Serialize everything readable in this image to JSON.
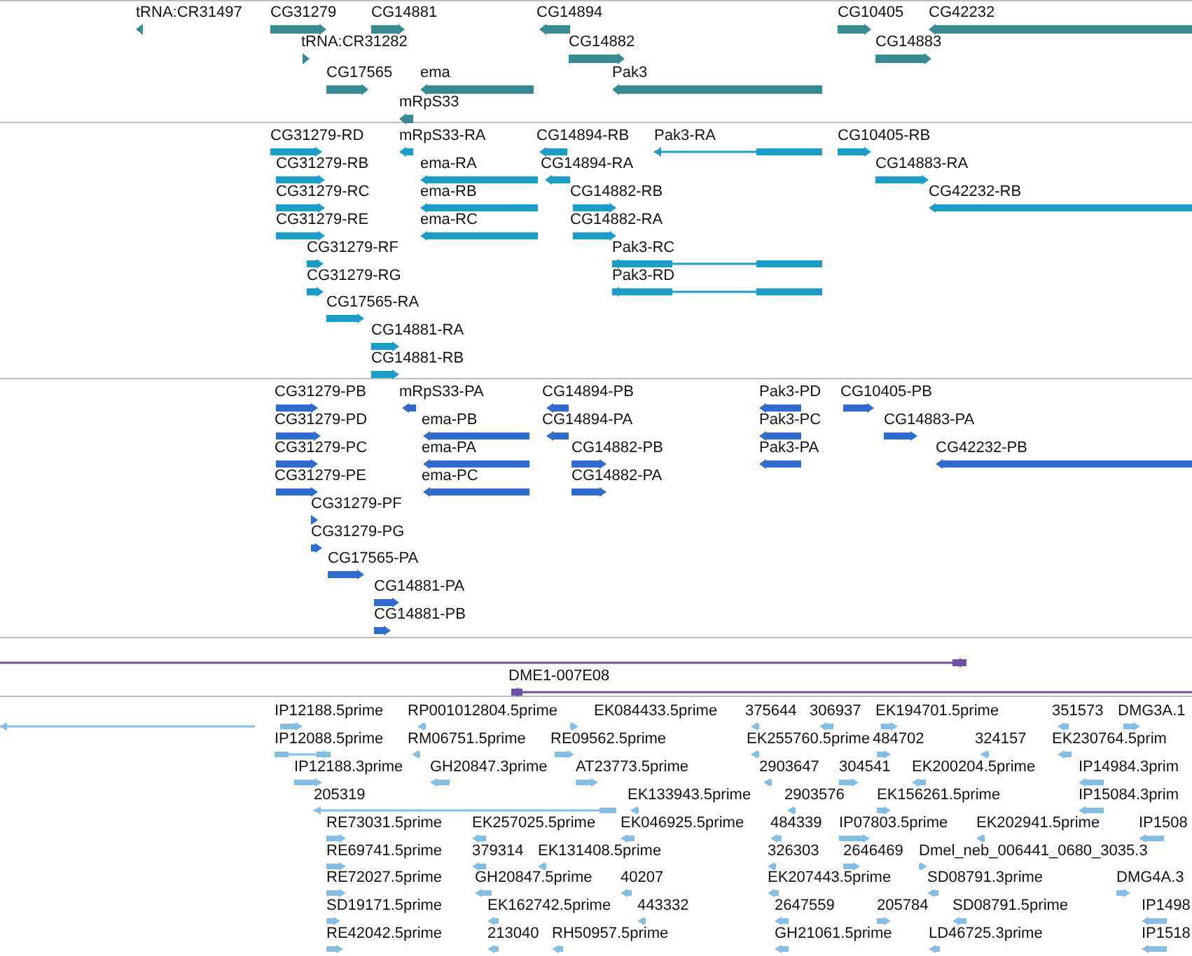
{
  "tracks": [
    {
      "color": "#368c92",
      "features": [
        {
          "label": "tRNA:CR31497",
          "reverse_strand": true
        },
        {
          "label": "CG31279",
          "reverse_strand": false
        },
        {
          "label": "CG14881",
          "reverse_strand": false
        },
        {
          "label": "CG14894",
          "reverse_strand": true
        },
        {
          "label": "CG10405",
          "reverse_strand": false
        },
        {
          "label": "CG42232",
          "reverse_strand": true
        },
        {
          "label": "tRNA:CR31282",
          "reverse_strand": false
        },
        {
          "label": "CG14882",
          "reverse_strand": false
        },
        {
          "label": "CG14883",
          "reverse_strand": false
        },
        {
          "label": "CG17565",
          "reverse_strand": false
        },
        {
          "label": "ema",
          "reverse_strand": true
        },
        {
          "label": "Pak3",
          "reverse_strand": true
        },
        {
          "label": "mRpS33",
          "reverse_strand": true
        }
      ]
    },
    {
      "color": "#1a9dc9",
      "features": [
        {
          "label": "CG31279-RD",
          "reverse_strand": false
        },
        {
          "label": "mRpS33-RA",
          "reverse_strand": true
        },
        {
          "label": "CG14894-RB",
          "reverse_strand": true
        },
        {
          "label": "Pak3-RA",
          "reverse_strand": true
        },
        {
          "label": "CG10405-RB",
          "reverse_strand": false
        },
        {
          "label": "CG31279-RB",
          "reverse_strand": false
        },
        {
          "label": "ema-RA",
          "reverse_strand": true
        },
        {
          "label": "CG14894-RA",
          "reverse_strand": true
        },
        {
          "label": "CG14883-RA",
          "reverse_strand": false
        },
        {
          "label": "CG31279-RC",
          "reverse_strand": false
        },
        {
          "label": "ema-RB",
          "reverse_strand": true
        },
        {
          "label": "CG14882-RB",
          "reverse_strand": false
        },
        {
          "label": "CG42232-RB",
          "reverse_strand": true
        },
        {
          "label": "CG31279-RE",
          "reverse_strand": false
        },
        {
          "label": "ema-RC",
          "reverse_strand": true
        },
        {
          "label": "CG14882-RA",
          "reverse_strand": false
        },
        {
          "label": "CG31279-RF",
          "reverse_strand": false
        },
        {
          "label": "Pak3-RC",
          "reverse_strand": true
        },
        {
          "label": "CG31279-RG",
          "reverse_strand": false
        },
        {
          "label": "Pak3-RD",
          "reverse_strand": true
        },
        {
          "label": "CG17565-RA",
          "reverse_strand": false
        },
        {
          "label": "CG14881-RA",
          "reverse_strand": false
        },
        {
          "label": "CG14881-RB",
          "reverse_strand": false
        }
      ]
    },
    {
      "color": "#2f6bd0",
      "features": [
        {
          "label": "CG31279-PB",
          "reverse_strand": false
        },
        {
          "label": "mRpS33-PA",
          "reverse_strand": true
        },
        {
          "label": "CG14894-PB",
          "reverse_strand": true
        },
        {
          "label": "Pak3-PD",
          "reverse_strand": true
        },
        {
          "label": "CG10405-PB",
          "reverse_strand": false
        },
        {
          "label": "CG31279-PD",
          "reverse_strand": false
        },
        {
          "label": "ema-PB",
          "reverse_strand": true
        },
        {
          "label": "CG14894-PA",
          "reverse_strand": true
        },
        {
          "label": "Pak3-PC",
          "reverse_strand": true
        },
        {
          "label": "CG14883-PA",
          "reverse_strand": false
        },
        {
          "label": "CG31279-PC",
          "reverse_strand": false
        },
        {
          "label": "ema-PA",
          "reverse_strand": true
        },
        {
          "label": "CG14882-PB",
          "reverse_strand": false
        },
        {
          "label": "Pak3-PA",
          "reverse_strand": true
        },
        {
          "label": "CG42232-PB",
          "reverse_strand": true
        },
        {
          "label": "CG31279-PE",
          "reverse_strand": false
        },
        {
          "label": "ema-PC",
          "reverse_strand": true
        },
        {
          "label": "CG14882-PA",
          "reverse_strand": false
        },
        {
          "label": "CG31279-PF",
          "reverse_strand": false
        },
        {
          "label": "CG31279-PG",
          "reverse_strand": false
        },
        {
          "label": "CG17565-PA",
          "reverse_strand": false
        },
        {
          "label": "CG14881-PA",
          "reverse_strand": false
        },
        {
          "label": "CG14881-PB",
          "reverse_strand": false
        }
      ]
    },
    {
      "color": "#6e4fae",
      "features": [
        {
          "reverse_strand": false
        },
        {
          "label": "DME1-007E08",
          "reverse_strand": true
        }
      ]
    },
    {
      "color": "#86bde2",
      "features": [
        {
          "reverse_strand": true
        },
        {
          "label": "IP12188.5prime",
          "reverse_strand": false
        },
        {
          "label": "RP001012804.5prime",
          "reverse_strand": true
        },
        {
          "label": "EK084433.5prime",
          "reverse_strand": false
        },
        {
          "label": "375644",
          "reverse_strand": true
        },
        {
          "label": "306937",
          "reverse_strand": true
        },
        {
          "label": "EK194701.5prime",
          "reverse_strand": false
        },
        {
          "label": "351573",
          "reverse_strand": true
        },
        {
          "label": "DMG3A.1",
          "reverse_strand": false
        },
        {
          "label": "IP12088.5prime",
          "reverse_strand": false
        },
        {
          "label": "RM06751.5prime",
          "reverse_strand": true
        },
        {
          "label": "RE09562.5prime",
          "reverse_strand": false
        },
        {
          "label": "EK255760.5prime",
          "reverse_strand": true
        },
        {
          "label": "484702",
          "reverse_strand": false
        },
        {
          "label": "324157",
          "reverse_strand": true
        },
        {
          "label": "EK230764.5prim",
          "reverse_strand": true
        },
        {
          "label": "IP12188.3prime",
          "reverse_strand": false
        },
        {
          "label": "GH20847.3prime",
          "reverse_strand": true
        },
        {
          "label": "AT23773.5prime",
          "reverse_strand": false
        },
        {
          "label": "2903647",
          "reverse_strand": true
        },
        {
          "label": "304541",
          "reverse_strand": false
        },
        {
          "label": "EK200204.5prime",
          "reverse_strand": true
        },
        {
          "label": "IP14984.3prim",
          "reverse_strand": true
        },
        {
          "label": "205319",
          "reverse_strand": true
        },
        {
          "label": "EK133943.5prime",
          "reverse_strand": true
        },
        {
          "label": "2903576",
          "reverse_strand": true
        },
        {
          "label": "EK156261.5prime",
          "reverse_strand": false
        },
        {
          "label": "IP15084.3prim",
          "reverse_strand": true
        },
        {
          "label": "RE73031.5prime",
          "reverse_strand": false
        },
        {
          "label": "EK257025.5prime",
          "reverse_strand": true
        },
        {
          "label": "EK046925.5prime",
          "reverse_strand": true
        },
        {
          "label": "484339",
          "reverse_strand": true
        },
        {
          "label": "IP07803.5prime",
          "reverse_strand": false
        },
        {
          "label": "EK202941.5prime",
          "reverse_strand": true
        },
        {
          "label": "IP1508",
          "reverse_strand": true
        },
        {
          "label": "RE69741.5prime",
          "reverse_strand": false
        },
        {
          "label": "379314",
          "reverse_strand": true
        },
        {
          "label": "EK131408.5prime",
          "reverse_strand": true
        },
        {
          "label": "326303",
          "reverse_strand": true
        },
        {
          "label": "2646469",
          "reverse_strand": false
        },
        {
          "label": "Dmel_neb_006441_0680_3035.3",
          "reverse_strand": false
        },
        {
          "label": "RE72027.5prime",
          "reverse_strand": false
        },
        {
          "label": "GH20847.5prime",
          "reverse_strand": true
        },
        {
          "label": "40207",
          "reverse_strand": true
        },
        {
          "label": "EK207443.5prime",
          "reverse_strand": true
        },
        {
          "label": "SD08791.3prime",
          "reverse_strand": true
        },
        {
          "label": "DMG4A.3",
          "reverse_strand": false
        },
        {
          "label": "SD19171.5prime",
          "reverse_strand": false
        },
        {
          "label": "EK162742.5prime",
          "reverse_strand": true
        },
        {
          "label": "443332",
          "reverse_strand": true
        },
        {
          "label": "2647559",
          "reverse_strand": true
        },
        {
          "label": "205784",
          "reverse_strand": false
        },
        {
          "label": "SD08791.5prime",
          "reverse_strand": true
        },
        {
          "label": "IP1498",
          "reverse_strand": true
        },
        {
          "label": "RE42042.5prime",
          "reverse_strand": false
        },
        {
          "label": "213040",
          "reverse_strand": true
        },
        {
          "label": "RH50957.5prime",
          "reverse_strand": true
        },
        {
          "label": "GH21061.5prime",
          "reverse_strand": true
        },
        {
          "label": "LD46725.3prime",
          "reverse_strand": true
        },
        {
          "label": "IP1518",
          "reverse_strand": true
        }
      ]
    }
  ]
}
